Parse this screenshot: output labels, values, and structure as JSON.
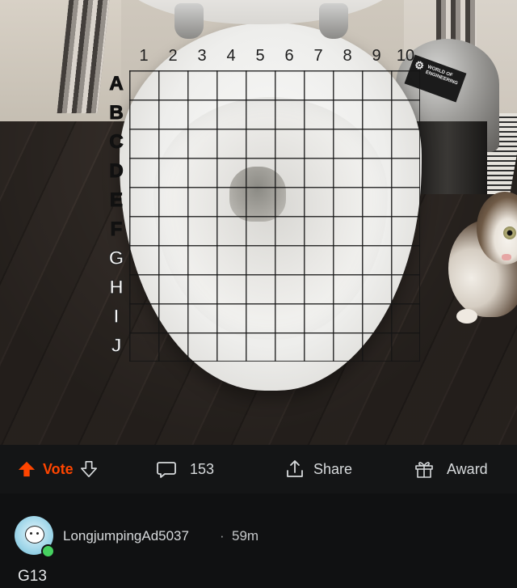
{
  "post": {
    "image": {
      "grid": {
        "columns": [
          "1",
          "2",
          "3",
          "4",
          "5",
          "6",
          "7",
          "8",
          "9",
          "10"
        ],
        "rows": [
          "A",
          "B",
          "C",
          "D",
          "E",
          "F",
          "G",
          "H",
          "I",
          "J"
        ]
      },
      "bin_label_line1": "WORLD OF",
      "bin_label_line2": "ENGINEERING"
    },
    "actions": {
      "vote_label": "Vote",
      "comment_count": "153",
      "share_label": "Share",
      "award_label": "Award"
    },
    "colors": {
      "vote_accent": "#ff4500",
      "online_status": "#46d160"
    }
  },
  "comment": {
    "username": "LongjumpingAd5037",
    "separator": "·",
    "timestamp": "59m",
    "body": "G13"
  }
}
